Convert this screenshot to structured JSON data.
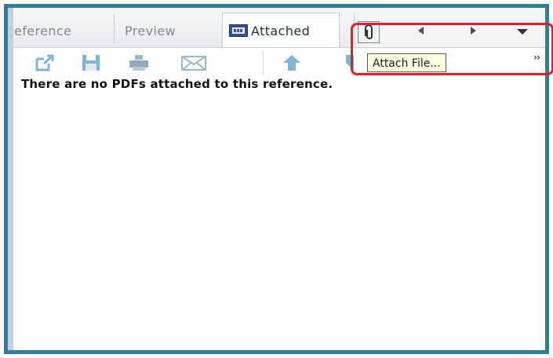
{
  "tabs": {
    "reference_label": "eference",
    "preview_label": "Preview",
    "attached_label": "Attached"
  },
  "icons": {
    "attached_tab": "pdf-document-icon",
    "clip": "paperclip-icon",
    "prev": "triangle-left-icon",
    "next": "triangle-right-icon",
    "menu": "triangle-down-icon",
    "open_external": "open-external-icon",
    "save": "floppy-disk-icon",
    "print": "printer-icon",
    "email": "envelope-icon",
    "move_up": "arrow-up-icon",
    "move_down": "arrow-down-icon",
    "overflow": "chevron-double-right-icon"
  },
  "tooltip": {
    "text": "Attach File..."
  },
  "main": {
    "message": "There are no PDFs attached to this reference."
  },
  "colors": {
    "frame_border": "#2f7f9a",
    "highlight": "#e01e2b",
    "tooltip_bg": "#ffffe1",
    "toolbar_icon": "#7fb4d3"
  }
}
